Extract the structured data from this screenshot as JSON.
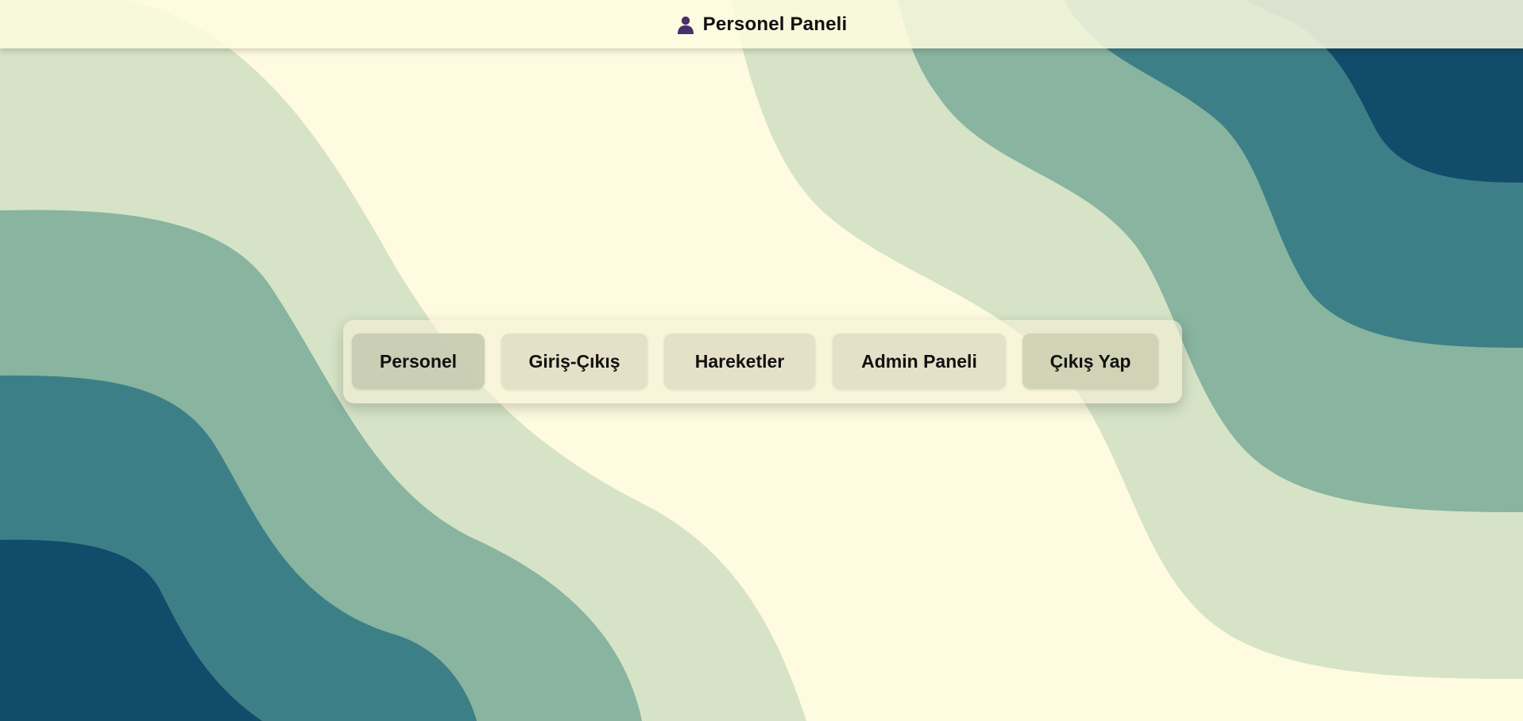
{
  "header": {
    "icon": "user-icon",
    "title": "Personel Paneli"
  },
  "nav": {
    "items": [
      {
        "label": "Personel",
        "active": true
      },
      {
        "label": "Giriş-Çıkış",
        "active": false
      },
      {
        "label": "Hareketler",
        "active": false
      },
      {
        "label": "Admin Paneli",
        "active": false
      },
      {
        "label": "Çıkış Yap",
        "active": false
      }
    ]
  },
  "colors": {
    "background": "#fefbe0",
    "wave_light": "#d6e3c6",
    "wave_mid": "#88b4a0",
    "wave_teal": "#3d7f87",
    "wave_dark": "#114c6a",
    "icon": "#4a2f6e"
  }
}
